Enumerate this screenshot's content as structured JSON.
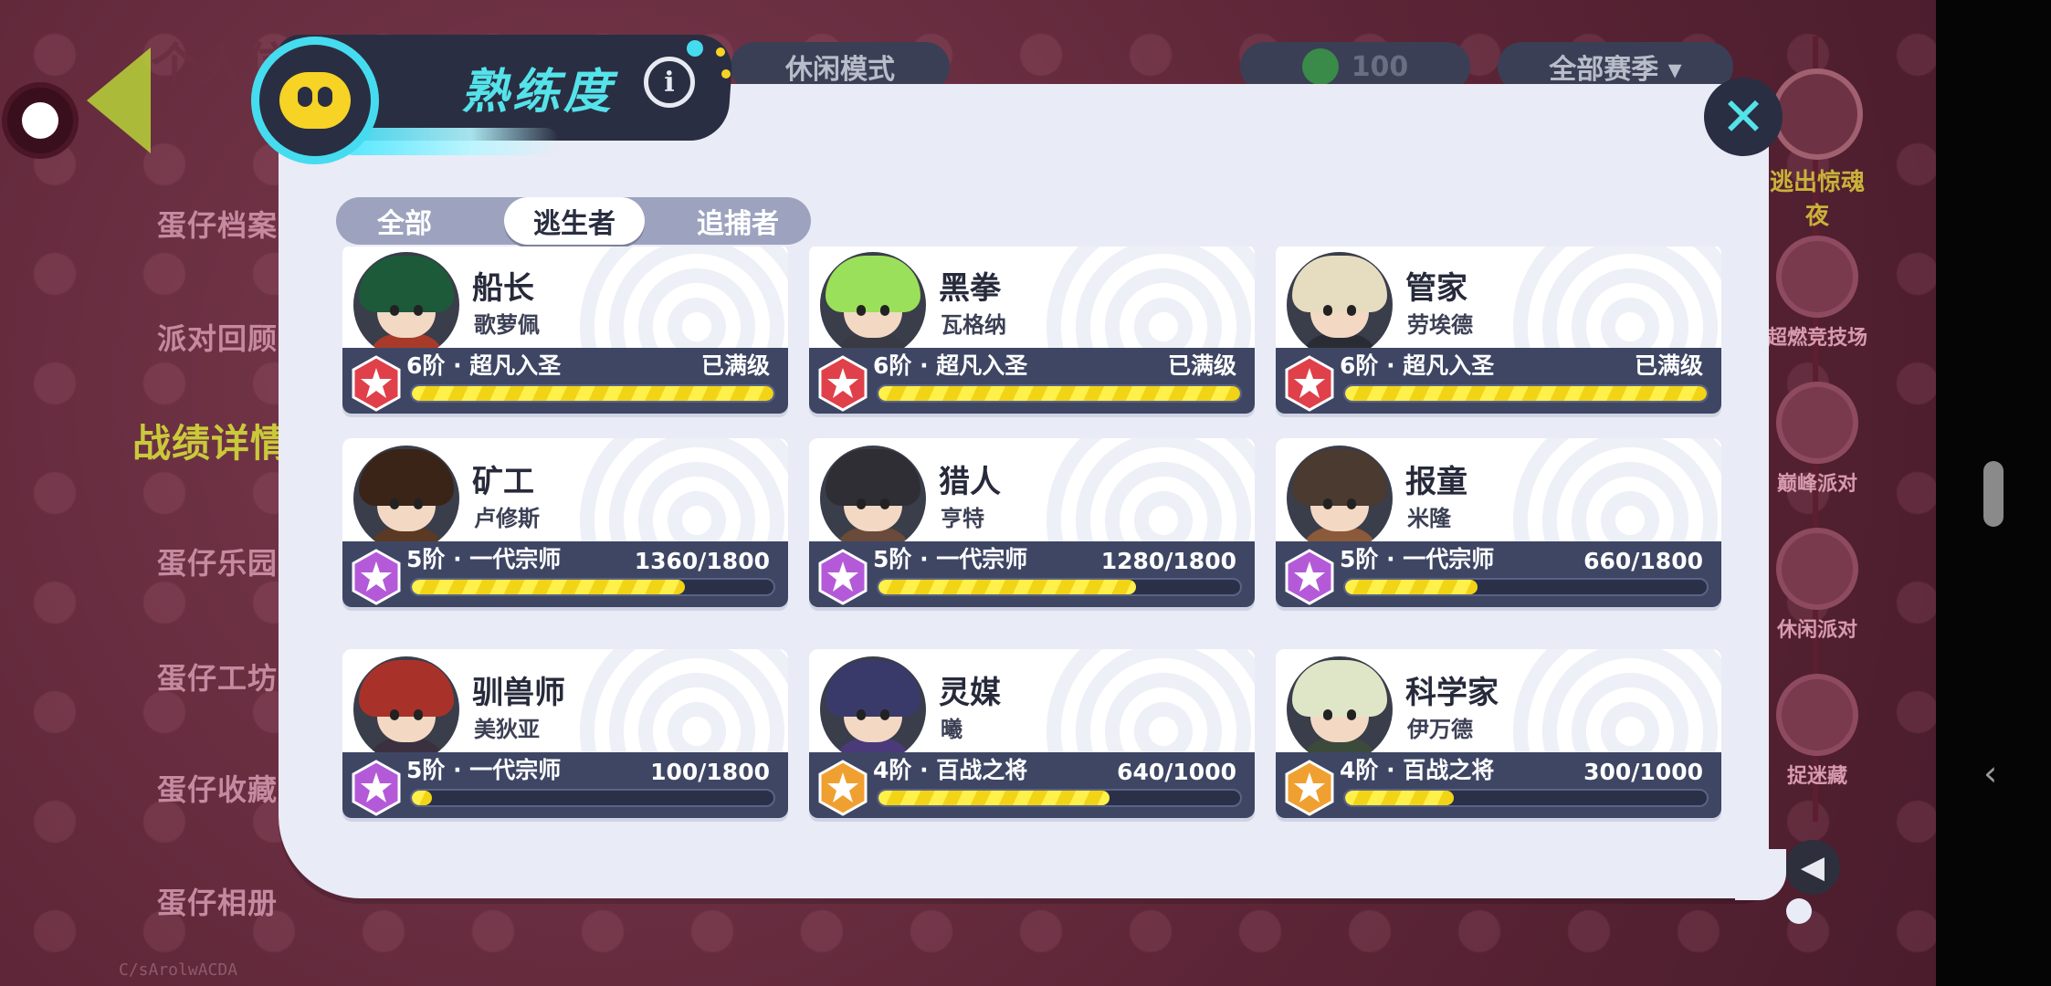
{
  "background": {
    "page_title": "个人信息",
    "menu": [
      "蛋仔档案",
      "派对回顾",
      "战绩详情",
      "蛋仔乐园",
      "蛋仔工坊",
      "蛋仔收藏",
      "蛋仔相册"
    ],
    "chips": {
      "mode": "休闲模式",
      "likes": "100",
      "season": "全部赛季 ▾"
    },
    "right_items": [
      "逃出惊魂夜",
      "超燃竞技场",
      "巅峰派对",
      "休闲派对",
      "捉迷藏"
    ],
    "watermark": "C/sArolwACDA"
  },
  "modal": {
    "title": "熟练度",
    "info_icon": "info-icon",
    "close_icon": "close-icon",
    "tabs": [
      {
        "label": "全部",
        "selected": false
      },
      {
        "label": "逃生者",
        "selected": true
      },
      {
        "label": "追捕者",
        "selected": false
      }
    ],
    "cards": [
      {
        "name": "船长",
        "sub": "歌萝佩",
        "rank": "6阶 · 超凡入圣",
        "progress_text": "已满级",
        "progress": 1.0,
        "rank_color": "#e0404a",
        "hair": "#1c5a3a",
        "body": "#a83a2a"
      },
      {
        "name": "黑拳",
        "sub": "瓦格纳",
        "rank": "6阶 · 超凡入圣",
        "progress_text": "已满级",
        "progress": 1.0,
        "rank_color": "#e0404a",
        "hair": "#9be05a",
        "body": "#3a3a44"
      },
      {
        "name": "管家",
        "sub": "劳埃德",
        "rank": "6阶 · 超凡入圣",
        "progress_text": "已满级",
        "progress": 1.0,
        "rank_color": "#e0404a",
        "hair": "#e6dcc0",
        "body": "#2a2c34"
      },
      {
        "name": "矿工",
        "sub": "卢修斯",
        "rank": "5阶 · 一代宗师",
        "progress_text": "1360/1800",
        "progress": 0.7556,
        "rank_color": "#b45ad8",
        "hair": "#3a2418",
        "body": "#5a3a22"
      },
      {
        "name": "猎人",
        "sub": "亨特",
        "rank": "5阶 · 一代宗师",
        "progress_text": "1280/1800",
        "progress": 0.7111,
        "rank_color": "#b45ad8",
        "hair": "#2e2e34",
        "body": "#6a4a3a"
      },
      {
        "name": "报童",
        "sub": "米隆",
        "rank": "5阶 · 一代宗师",
        "progress_text": "660/1800",
        "progress": 0.3667,
        "rank_color": "#b45ad8",
        "hair": "#4a3a30",
        "body": "#8a5a3a"
      },
      {
        "name": "驯兽师",
        "sub": "美狄亚",
        "rank": "5阶 · 一代宗师",
        "progress_text": "100/1800",
        "progress": 0.0556,
        "rank_color": "#b45ad8",
        "hair": "#a8322a",
        "body": "#3a3040"
      },
      {
        "name": "灵媒",
        "sub": "曦",
        "rank": "4阶 · 百战之将",
        "progress_text": "640/1000",
        "progress": 0.64,
        "rank_color": "#f0a030",
        "hair": "#3a3a6a",
        "body": "#4a3a7a"
      },
      {
        "name": "科学家",
        "sub": "伊万德",
        "rank": "4阶 · 百战之将",
        "progress_text": "300/1000",
        "progress": 0.3,
        "rank_color": "#f0a030",
        "hair": "#dfe6c8",
        "body": "#3c4a3c"
      }
    ]
  }
}
